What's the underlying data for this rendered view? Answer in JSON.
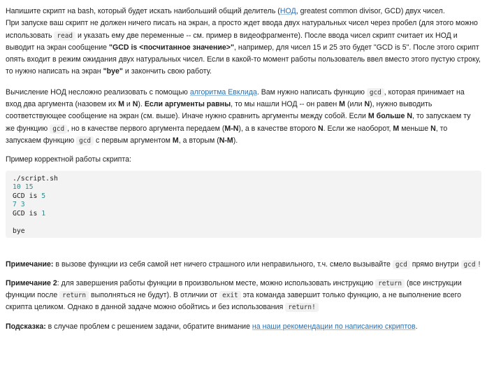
{
  "para1": {
    "t1": "Напишите скрипт на bash, который будет искать наибольший общий делитель (",
    "link": "НОД",
    "t2": ", greatest common divisor, GCD) двух чисел.",
    "t3": "При запуске ваш скрипт не должен ничего писать на экран, а просто ждет ввода двух натуральных чисел через пробел (для этого можно использовать ",
    "code_read": "read",
    "t4": " и указать ему две переменные -- см. пример в видеофрагменте). После ввода чисел скрипт считает их НОД и выводит на экран сообщение ",
    "bold1": "\"GCD is <посчитанное значение>\"",
    "t5": ", например, для чисел 15 и 25 это будет \"GCD is 5\". После этого скрипт опять входит в режим ожидания двух натуральных чисел. Если в какой-то момент работы пользователь ввел вместо этого пустую строку, то нужно написать на экран ",
    "bold2": "\"bye\"",
    "t6": " и закончить свою работу."
  },
  "para2": {
    "t1": "Вычисление НОД несложно реализовать с помощью ",
    "link": "алгоритма Евклида",
    "t2": ". Вам нужно написать функцию ",
    "code_gcd": "gcd",
    "t3": ", которая принимает на вход два аргумента (назовем их ",
    "M": "M",
    "and1": " и ",
    "N": "N",
    "t4": "). ",
    "bold_equal": "Если аргументы равны",
    "t5": ", то мы нашли НОД -- он равен ",
    "t6": " (или ",
    "t7": "), нужно выводить соответствующее сообщение на экран (см. выше). Иначе нужно сравнить аргументы между собой. Если ",
    "bold_more": "M больше N",
    "t8": ", то запускаем ту же функцию ",
    "t9": ", но в качестве первого аргумента передаем (",
    "MminusN": "M-N",
    "t10": "), а в качестве второго ",
    "t11": ". Если же наоборот, ",
    "less": " меньше ",
    "t12": ", то запускаем функцию ",
    "t13": " с первым аргументом ",
    "t14": ", а вторым (",
    "NminusM": "N-M",
    "t15": ")."
  },
  "example_label": "Пример корректной работы скрипта:",
  "code_block": {
    "l1": "./script.sh",
    "l2": "10 15",
    "l3a": "GCD is ",
    "l3b": "5",
    "l4": "7 3",
    "l5a": "GCD is ",
    "l5b": "1",
    "l7": "bye"
  },
  "note1": {
    "bold": "Примечание:",
    "t1": " в вызове функции из себя самой нет ничего страшного или неправильного, т.ч. смело вызывайте ",
    "code": "gcd",
    "t2": " прямо внутри ",
    "t3": "!"
  },
  "note2": {
    "bold": "Примечание 2",
    "t1": ": для завершения работы функции в произвольном месте, можно использовать инструкцию ",
    "code_return": "return",
    "t2": " (все инструкции функции после ",
    "t3": " выполняться не будут). В отличии от ",
    "code_exit": "exit",
    "t4": " эта команда завершит только функцию, а не выполнение всего скрипта целиком. Однако в данной задаче можно обойтись и без использования ",
    "code_return_bang": "return!"
  },
  "hint": {
    "bold": "Подсказка:",
    "t1": " в случае проблем с решением задачи, обратите внимание ",
    "link": "на наши рекомендации по написанию скриптов",
    "t2": "."
  }
}
